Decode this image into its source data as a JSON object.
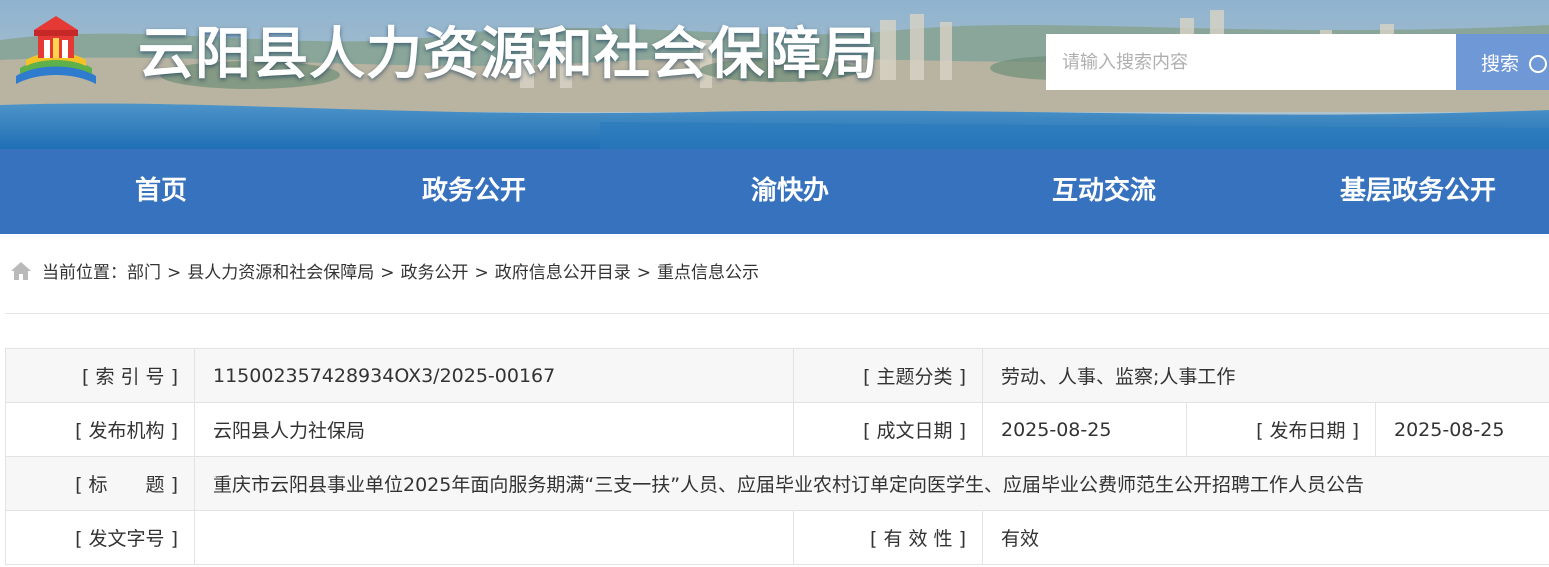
{
  "header": {
    "site_title": "云阳县人力资源和社会保障局",
    "search_placeholder": "请输入搜索内容",
    "search_button": "搜索"
  },
  "nav": {
    "items": [
      {
        "label": "首页"
      },
      {
        "label": "政务公开"
      },
      {
        "label": "渝快办"
      },
      {
        "label": "互动交流"
      },
      {
        "label": "基层政务公开"
      }
    ]
  },
  "breadcrumb": {
    "prefix": "当前位置：",
    "items": [
      "部门",
      "县人力资源和社会保障局",
      "政务公开",
      "政府信息公开目录",
      "重点信息公示"
    ],
    "separator": ">"
  },
  "info_table": {
    "index_no_label": "[ 索 引 号 ]",
    "index_no_value": "115002357428934OX3/2025-00167",
    "topic_label": "[ 主题分类 ]",
    "topic_value": "劳动、人事、监察;人事工作",
    "publisher_label": "[ 发布机构 ]",
    "publisher_value": "云阳县人力社保局",
    "created_label": "[ 成文日期 ]",
    "created_value": "2025-08-25",
    "published_label": "[ 发布日期 ]",
    "published_value": "2025-08-25",
    "title_label": "[ 标　　题 ]",
    "title_value": "重庆市云阳县事业单位2025年面向服务期满“三支一扶”人员、应届毕业农村订单定向医学生、应届毕业公费师范生公开招聘工作人员公告",
    "doc_no_label": "[ 发文字号 ]",
    "doc_no_value": "",
    "validity_label": "[ 有 效 性 ]",
    "validity_value": "有效"
  },
  "colors": {
    "nav_bg": "#3772be",
    "search_button_bg": "#6f98d6",
    "table_shade": "#f7f7f7",
    "table_border": "#e3e3e3"
  }
}
